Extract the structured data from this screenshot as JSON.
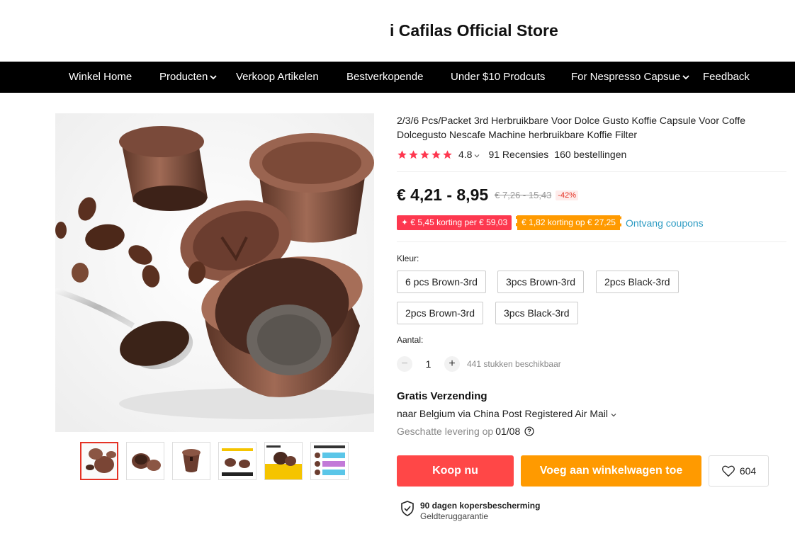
{
  "store": {
    "title": "i Cafilas Official Store"
  },
  "nav": {
    "items": [
      {
        "label": "Winkel Home"
      },
      {
        "label": "Producten"
      },
      {
        "label": "Verkoop Artikelen"
      },
      {
        "label": "Bestverkopende"
      },
      {
        "label": "Under $10 Prodcuts"
      },
      {
        "label": "For Nespresso Capsue"
      },
      {
        "label": "Feedback"
      }
    ]
  },
  "product": {
    "title": "2/3/6 Pcs/Packet 3rd Herbruikbare Voor Dolce Gusto Koffie Capsule Voor Coffe Dolcegusto Nescafe Machine herbruikbare Koffie Filter",
    "rating": "4.8",
    "reviews": "91 Recensies",
    "orders": "160 bestellingen",
    "stars": 5
  },
  "price": {
    "current": "€ 4,21 - 8,95",
    "original": "€ 7,26 - 15,43",
    "discount": "-42%"
  },
  "coupons": {
    "first": "✦ € 5,45 korting per € 59,03",
    "second": "€ 1,82 korting op € 27,25",
    "link": "Ontvang coupons"
  },
  "color": {
    "label": "Kleur:",
    "options": [
      {
        "label": "6 pcs Brown-3rd"
      },
      {
        "label": "3pcs Brown-3rd"
      },
      {
        "label": "2pcs Black-3rd"
      },
      {
        "label": "2pcs Brown-3rd"
      },
      {
        "label": "3pcs Black-3rd"
      }
    ]
  },
  "quantity": {
    "label": "Aantal:",
    "value": "1",
    "available": "441 stukken beschikbaar",
    "minus": "−",
    "plus": "+"
  },
  "shipping": {
    "title": "Gratis Verzending",
    "destination": "naar Belgium via China Post Registered Air Mail",
    "eta_label": "Geschatte levering op",
    "eta_date": "01/08"
  },
  "actions": {
    "buy": "Koop nu",
    "cart": "Voeg aan winkelwagen toe",
    "wishlist_count": "604"
  },
  "protection": {
    "title": "90 dagen kopersbescherming",
    "subtitle": "Geldteruggarantie"
  },
  "colors": {
    "accent": "#ff4747",
    "cart": "#ff9a00",
    "link": "#2e9cc3",
    "star": "#fe374f"
  }
}
